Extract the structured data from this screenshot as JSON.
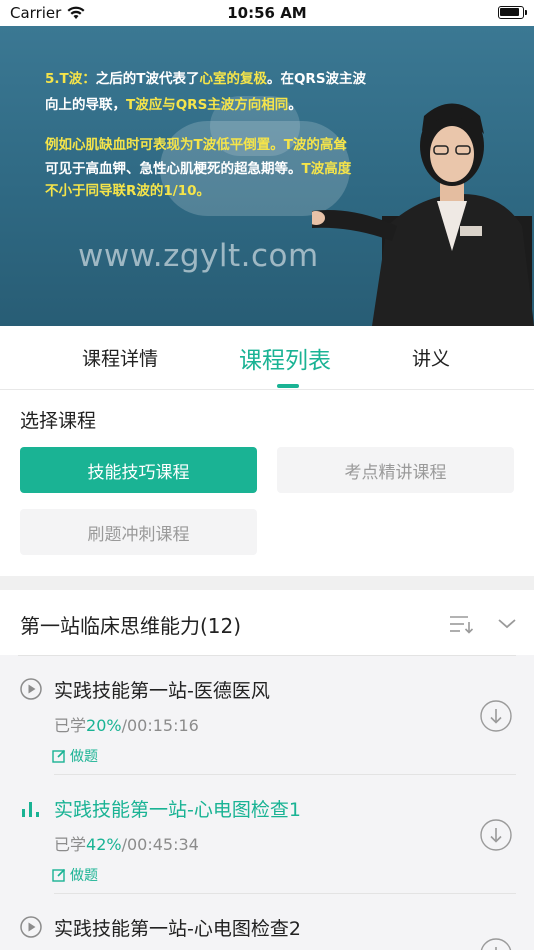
{
  "status_bar": {
    "carrier": "Carrier",
    "time": "10:56 AM",
    "battery_level": 0.9
  },
  "video": {
    "lines": [
      {
        "parts": [
          {
            "t": "5.T波：",
            "c": "y"
          },
          {
            "t": "之后的T波代表了",
            "c": "w"
          },
          {
            "t": "心室的复极",
            "c": "y"
          },
          {
            "t": "。在QRS波主波",
            "c": "w"
          }
        ]
      },
      {
        "parts": [
          {
            "t": "向上的导联，",
            "c": "w"
          },
          {
            "t": "T波应与QRS主波方向相同",
            "c": "y"
          },
          {
            "t": "。",
            "c": "w"
          }
        ]
      },
      {
        "parts": [
          {
            "t": "例如心肌缺血时可表现为T波低平倒置。T波的高耸",
            "c": "y"
          }
        ]
      },
      {
        "parts": [
          {
            "t": "可见于高血钾、急性心肌梗死的超急期等。",
            "c": "w"
          },
          {
            "t": "T波高度",
            "c": "y"
          }
        ]
      },
      {
        "parts": [
          {
            "t": "不小于同导联R波的1/10。",
            "c": "y"
          }
        ]
      }
    ],
    "watermark": "www.zgylt.com"
  },
  "tabs": [
    {
      "label": "课程详情",
      "active": false
    },
    {
      "label": "课程列表",
      "active": true
    },
    {
      "label": "讲义",
      "active": false
    }
  ],
  "course_select": {
    "title": "选择课程",
    "options": [
      {
        "label": "技能技巧课程",
        "selected": true
      },
      {
        "label": "考点精讲课程",
        "selected": false
      },
      {
        "label": "刷题冲刺课程",
        "selected": false
      }
    ]
  },
  "section": {
    "title": "第一站临床思维能力(12)"
  },
  "lessons": [
    {
      "title": "实践技能第一站-医德医风",
      "studied_prefix": "已学",
      "percent": "20%",
      "duration": "/00:15:16",
      "quiz_label": "做题",
      "playing": false
    },
    {
      "title": "实践技能第一站-心电图检查1",
      "studied_prefix": "已学",
      "percent": "42%",
      "duration": "/00:45:34",
      "quiz_label": "做题",
      "playing": true
    },
    {
      "title": "实践技能第一站-心电图检查2",
      "studied_prefix": "",
      "percent": "",
      "duration": "",
      "quiz_label": "",
      "playing": false
    }
  ],
  "colors": {
    "accent": "#1ab394",
    "video_bg": "#3b7893",
    "slide_yellow": "#f5e44a"
  }
}
